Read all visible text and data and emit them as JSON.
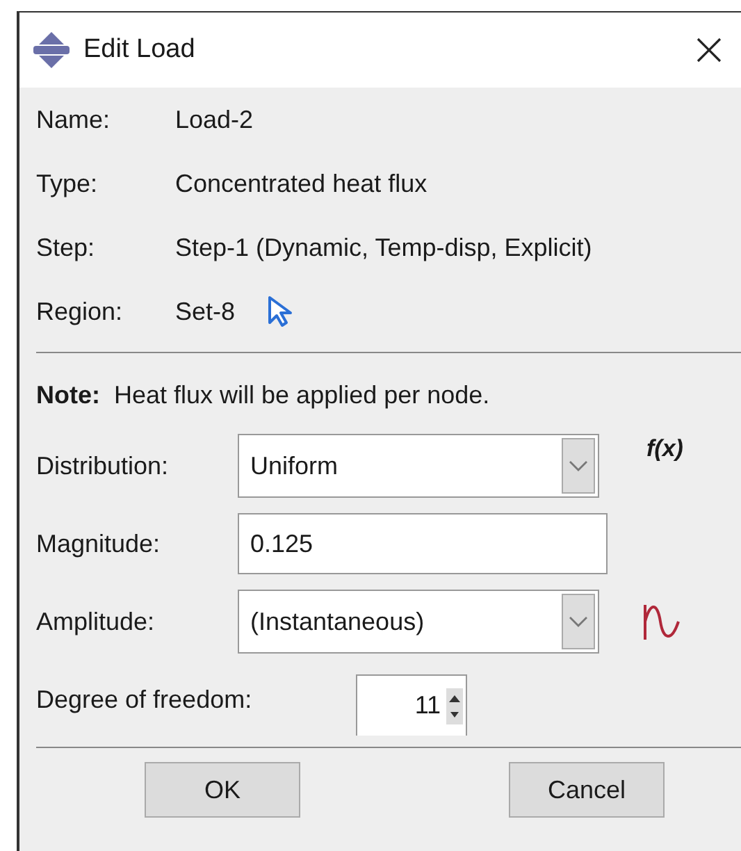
{
  "window": {
    "title": "Edit Load"
  },
  "info": [
    {
      "label": "Name:",
      "value": "Load-2"
    },
    {
      "label": "Type:",
      "value": "Concentrated heat flux"
    },
    {
      "label": "Step:",
      "value": "Step-1 (Dynamic, Temp-disp, Explicit)"
    },
    {
      "label": "Region:",
      "value": "Set-8"
    }
  ],
  "note": {
    "label": "Note:",
    "text": "Heat flux will be applied per node."
  },
  "fields": [
    {
      "kind": "dropdown",
      "label": "Distribution:",
      "value": "Uniform",
      "action": {
        "kind": "formula",
        "text": "f(x)"
      }
    },
    {
      "kind": "text",
      "label": "Magnitude:",
      "value": "0.125"
    },
    {
      "kind": "dropdown",
      "label": "Amplitude:",
      "value": "(Instantaneous)",
      "action": {
        "kind": "wave"
      }
    }
  ],
  "dof": {
    "label": "Degree of freedom:",
    "value": "11"
  },
  "buttons": [
    "OK",
    "Cancel"
  ]
}
